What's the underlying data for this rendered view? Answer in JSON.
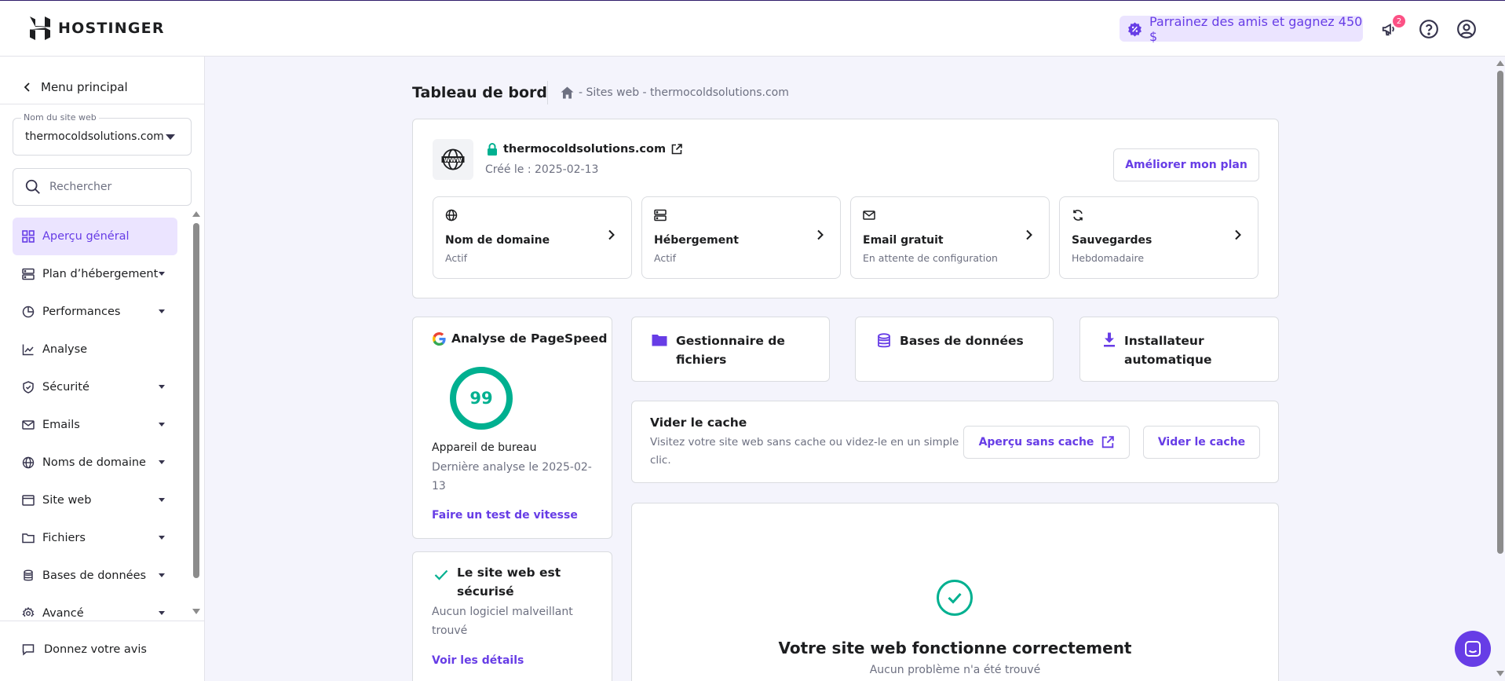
{
  "header": {
    "logo_text": "HOSTINGER",
    "referral_label": "Parrainez des amis et gagnez 450 $",
    "notification_count": "2",
    "icons": [
      "megaphone-icon",
      "help-icon",
      "account-icon"
    ]
  },
  "sidebar": {
    "back_label": "Menu principal",
    "site_select": {
      "label": "Nom du site web",
      "value": "thermocoldsolutions.com"
    },
    "search": {
      "placeholder": "Rechercher"
    },
    "items": [
      {
        "label": "Aperçu général",
        "icon": "grid-icon",
        "active": true,
        "expandable": false
      },
      {
        "label": "Plan d’hébergement",
        "icon": "server-icon",
        "expandable": true
      },
      {
        "label": "Performances",
        "icon": "pie-chart-icon",
        "expandable": true
      },
      {
        "label": "Analyse",
        "icon": "trend-icon",
        "expandable": false
      },
      {
        "label": "Sécurité",
        "icon": "shield-icon",
        "expandable": true
      },
      {
        "label": "Emails",
        "icon": "mail-icon",
        "expandable": true
      },
      {
        "label": "Noms de domaine",
        "icon": "globe-icon",
        "expandable": true
      },
      {
        "label": "Site web",
        "icon": "browser-icon",
        "expandable": true
      },
      {
        "label": "Fichiers",
        "icon": "folder-icon",
        "expandable": true
      },
      {
        "label": "Bases de données",
        "icon": "database-icon",
        "expandable": true
      },
      {
        "label": "Avancé",
        "icon": "gear-icon",
        "expandable": true
      }
    ],
    "feedback_label": "Donnez votre avis"
  },
  "main": {
    "title": "Tableau de bord",
    "breadcrumb": "- Sites web - thermocoldsolutions.com",
    "site": {
      "domain": "thermocoldsolutions.com",
      "created": "Créé le : 2025-02-13",
      "upgrade_label": "Améliorer mon plan"
    },
    "tiles": [
      {
        "title": "Nom de domaine",
        "status": "Actif",
        "icon": "globe-icon"
      },
      {
        "title": "Hébergement",
        "status": "Actif",
        "icon": "server-icon"
      },
      {
        "title": "Email gratuit",
        "status": "En attente de configuration",
        "icon": "mail-icon"
      },
      {
        "title": "Sauvegardes",
        "status": "Hebdomadaire",
        "icon": "refresh-icon"
      }
    ],
    "pagespeed": {
      "title": "Analyse de PageSpeed",
      "score": "99",
      "score_value": 99,
      "device": "Appareil de bureau",
      "last_line1": "Dernière analyse le 2025-02-",
      "last_line2": "13",
      "link": "Faire un test de vitesse",
      "color": "#00b090"
    },
    "security": {
      "title_line1": "Le site web est",
      "title_line2": "sécurisé",
      "desc_line1": "Aucun logiciel malveillant",
      "desc_line2": "trouvé",
      "link": "Voir les détails"
    },
    "quick": [
      {
        "line1": "Gestionnaire de",
        "line2": "fichiers",
        "icon": "folder-icon"
      },
      {
        "line1": "Bases de données",
        "line2": "",
        "icon": "database-icon"
      },
      {
        "line1": "Installateur",
        "line2": "automatique",
        "icon": "download-icon"
      }
    ],
    "cache": {
      "title": "Vider le cache",
      "desc_line1": "Visitez votre site web sans cache ou videz-le en un simple",
      "desc_line2": "clic.",
      "preview_label": "Aperçu sans cache",
      "clear_label": "Vider le cache"
    },
    "status": {
      "title": "Votre site web fonctionne correctement",
      "subtitle": "Aucun problème n'a été trouvé"
    }
  },
  "colors": {
    "accent": "#673de6",
    "accent_light": "#ebe4ff",
    "success": "#00b090",
    "text": "#1d1e20",
    "muted": "#6d7081"
  }
}
